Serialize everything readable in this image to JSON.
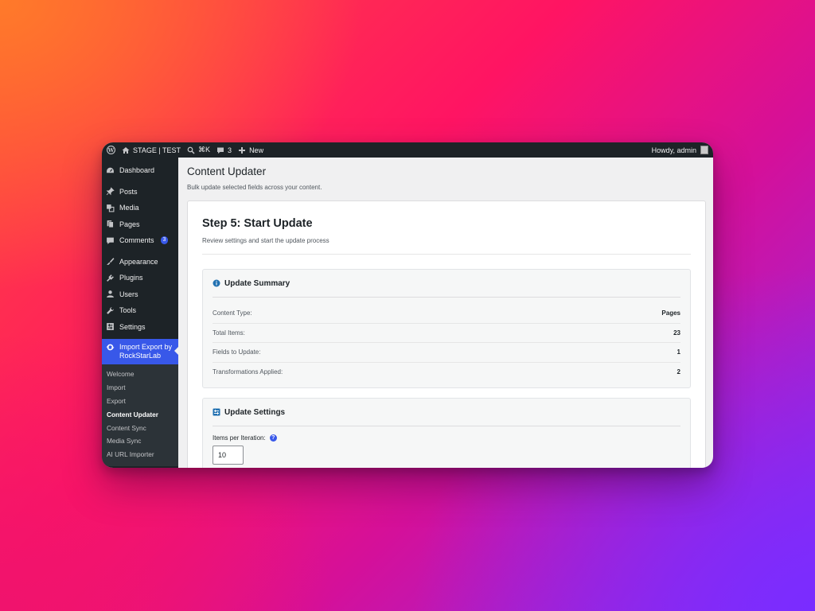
{
  "adminbar": {
    "site_name": "STAGE | TEST",
    "shortcut": "⌘K",
    "comments_count": "3",
    "new_label": "New",
    "howdy": "Howdy, admin"
  },
  "sidebar": {
    "items": [
      {
        "label": "Dashboard",
        "icon": "dashboard-icon"
      },
      {
        "label": "Posts",
        "icon": "pin-icon"
      },
      {
        "label": "Media",
        "icon": "media-icon"
      },
      {
        "label": "Pages",
        "icon": "pages-icon"
      },
      {
        "label": "Comments",
        "icon": "comment-icon",
        "badge": "3"
      },
      {
        "label": "Appearance",
        "icon": "brush-icon"
      },
      {
        "label": "Plugins",
        "icon": "plug-icon"
      },
      {
        "label": "Users",
        "icon": "user-icon"
      },
      {
        "label": "Tools",
        "icon": "wrench-icon"
      },
      {
        "label": "Settings",
        "icon": "settings-icon"
      }
    ],
    "active_plugin": "Import Export by RockStarLab",
    "submenu": [
      "Welcome",
      "Import",
      "Export",
      "Content Updater",
      "Content Sync",
      "Media Sync",
      "AI URL Importer"
    ]
  },
  "page": {
    "title": "Content Updater",
    "description": "Bulk update selected fields across your content."
  },
  "step": {
    "title": "Step 5: Start Update",
    "description": "Review settings and start the update process"
  },
  "summary": {
    "title": "Update Summary",
    "rows": [
      {
        "label": "Content Type:",
        "value": "Pages"
      },
      {
        "label": "Total Items:",
        "value": "23"
      },
      {
        "label": "Fields to Update:",
        "value": "1"
      },
      {
        "label": "Transformations Applied:",
        "value": "2"
      }
    ]
  },
  "settings": {
    "title": "Update Settings",
    "items_per_iteration_label": "Items per Iteration:",
    "items_per_iteration_value": "10"
  },
  "colors": {
    "accent": "#3858e9",
    "admin_bar": "#1d2327"
  }
}
